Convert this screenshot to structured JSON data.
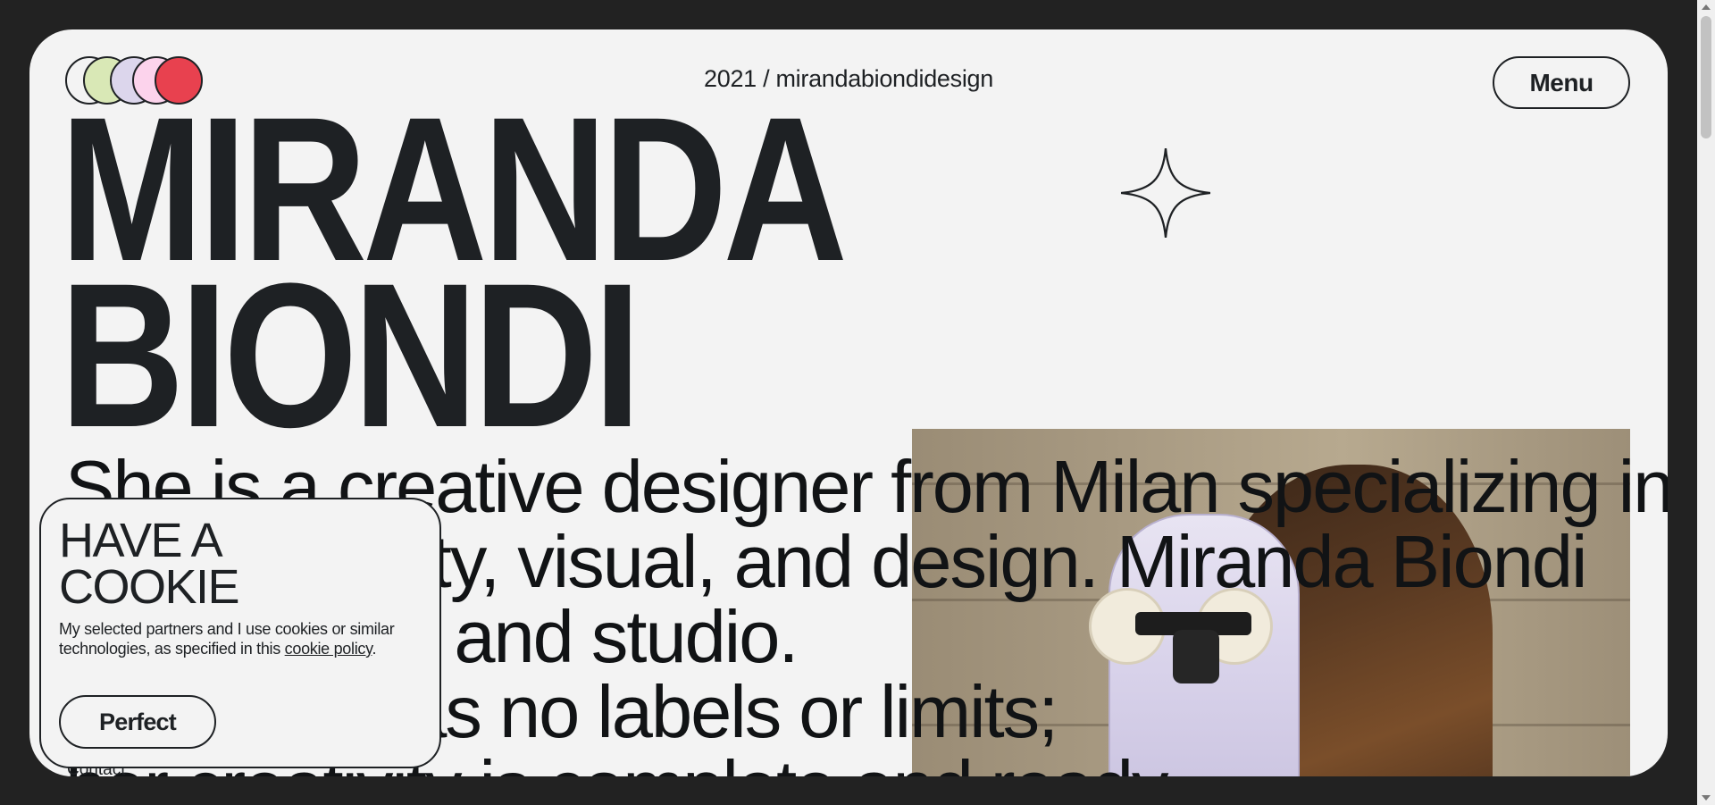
{
  "header": {
    "site_line": "2021 / mirandabiondidesign",
    "menu_label": "Menu",
    "logo_colors": [
      "#f3f3f3",
      "#d9e8b6",
      "#dcd6ec",
      "#fcd3ec",
      "#e8414f"
    ]
  },
  "hero": {
    "name": "MIRANDA\nBIONDI",
    "bio": "She is a creative designer from Milan specializing in\nbrand identity, visual, and design. Miranda Biondi\nis her brand and studio.\nHer work has no labels or limits;\nher creativity is complete and ready"
  },
  "footer_nav": {
    "contact_label": "Contact"
  },
  "cookie_banner": {
    "title": "HAVE A\nCOOKIE",
    "text_before": "My selected partners and I use cookies or similar technologies, as specified in this ",
    "link_text": "cookie policy",
    "text_after": ".",
    "accept_label": "Perfect"
  },
  "icons": {
    "star": "four-point-star-icon"
  },
  "colors": {
    "page_bg": "#222222",
    "card_bg": "#f3f3f3",
    "ink": "#1e2124",
    "accent_red": "#e8414f"
  }
}
